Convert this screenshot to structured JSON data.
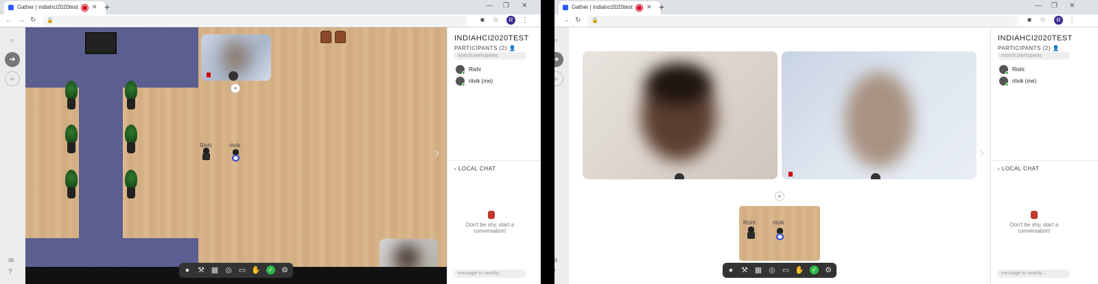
{
  "browser": {
    "tab_title": "Gather | indiahci2020test",
    "new_tab": "+",
    "profile_initial": "R"
  },
  "app": {
    "space_name": "INDIAHCI2020TEST",
    "participants_heading": "PARTICIPANTS (2)",
    "search_placeholder": "search participants",
    "participants": [
      {
        "name": "Rishi"
      },
      {
        "name": "ritvik (me)"
      }
    ],
    "local_chat": "LOCAL CHAT",
    "empty_chat": "Don't be shy, start a conversation!",
    "message_placeholder": "message to nearby..."
  },
  "game": {
    "avatars": [
      {
        "name": "Rishi"
      },
      {
        "name": "ritvik"
      }
    ]
  },
  "icons": {
    "search": "search-icon",
    "exit": "exit-icon",
    "add": "add-icon",
    "mail": "mail-icon",
    "help": "help-icon",
    "add_person": "add-person-icon",
    "chevron_left": "chevron-left-icon",
    "collapse": "chevron-double-down-icon",
    "expand": "chevron-double-up-icon"
  },
  "toolbar_items": [
    "avatar",
    "build",
    "map",
    "screen-record",
    "screen-share",
    "hand",
    "status",
    "settings"
  ],
  "colors": {
    "carpet": "#575a8c",
    "floor": "#d9b58a",
    "online": "#2fb94a",
    "toolbar": "#333333"
  }
}
